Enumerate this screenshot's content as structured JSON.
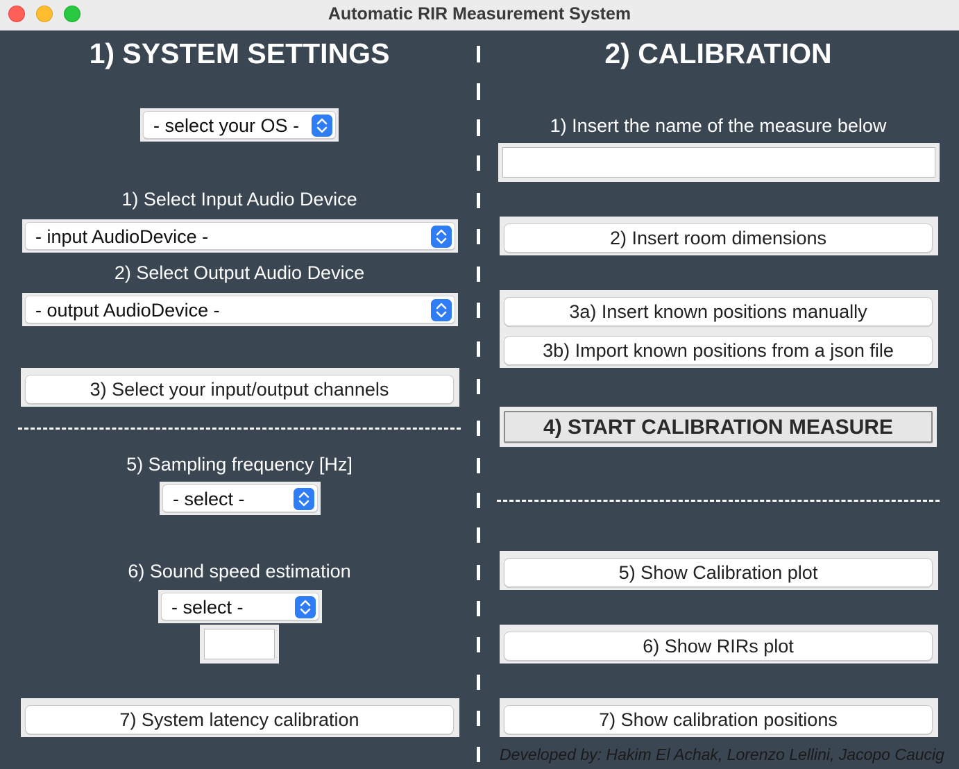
{
  "window": {
    "title": "Automatic RIR Measurement System"
  },
  "left": {
    "heading": "1) SYSTEM SETTINGS",
    "os_select": "- select your OS -",
    "input_label": "1) Select Input Audio Device",
    "input_select": "- input AudioDevice -",
    "output_label": "2) Select Output Audio Device",
    "output_select": "- output AudioDevice -",
    "channels_button": "3) Select your input/output channels",
    "sampling_label": "5) Sampling frequency [Hz]",
    "sampling_select": "- select -",
    "sound_speed_label": "6) Sound speed estimation",
    "sound_speed_select": "- select -",
    "sound_speed_value": "",
    "latency_button": "7) System latency calibration"
  },
  "right": {
    "heading": "2) CALIBRATION",
    "measure_name_label": "1) Insert the name of the measure below",
    "measure_name_value": "",
    "room_dimensions_button": "2) Insert room dimensions",
    "manual_positions_button": "3a) Insert known positions manually",
    "import_positions_button": "3b) Import known positions from a json file",
    "start_calibration_button": "4) START CALIBRATION MEASURE",
    "calibration_plot_button": "5) Show Calibration plot",
    "rirs_plot_button": "6) Show RIRs plot",
    "calibration_positions_button": "7) Show calibration positions"
  },
  "footer": {
    "credits": "Developed by: Hakim El Achak, Lorenzo Lellini, Jacopo Caucig"
  },
  "colors": {
    "background": "#3a4651",
    "accent": "#2e7cf6"
  }
}
